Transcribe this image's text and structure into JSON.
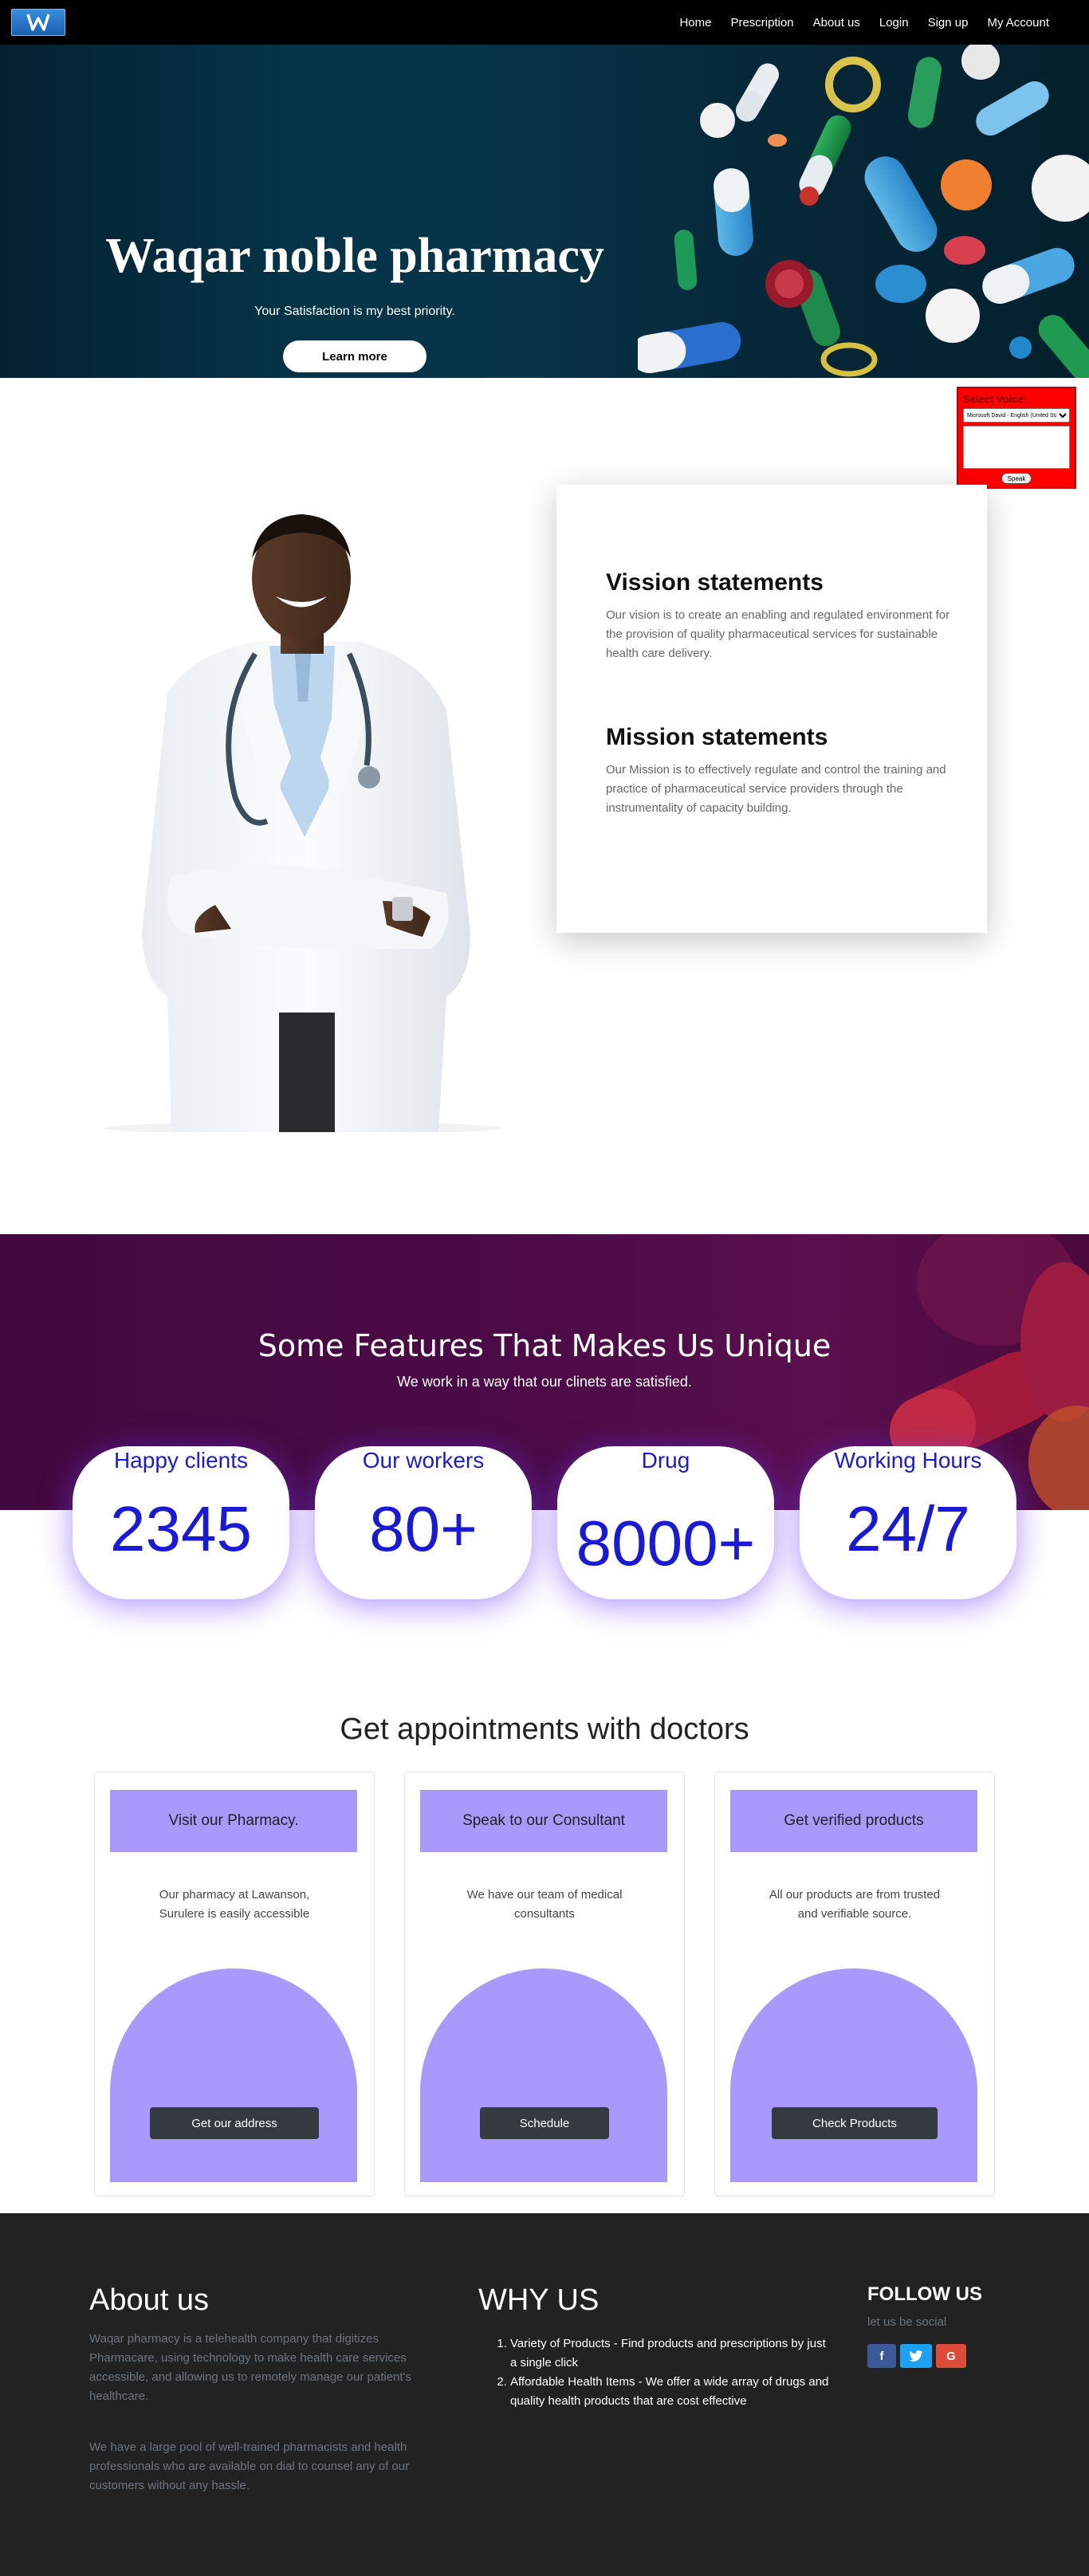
{
  "nav": {
    "logo_alt": "W",
    "links": [
      "Home",
      "Prescription",
      "About us",
      "Login",
      "Sign up",
      "My Account"
    ]
  },
  "hero": {
    "title": "Waqar noble pharmacy",
    "subtitle": "Your Satisfaction is my best priority.",
    "button": "Learn more"
  },
  "voice_widget": {
    "label": "Select Voice:",
    "selected_voice": "Microsoft David - English (United States)",
    "speak_button": "Speak"
  },
  "vision_mission": {
    "vision_title": "Vission statements",
    "vision_text": "Our vision is to create an enabling and regulated environment for the provision of quality pharmaceutical services for sustainable health care delivery.",
    "mission_title": "Mission statements",
    "mission_text": "Our Mission is to effectively regulate and control the training and practice of pharmaceutical service providers through the instrumentality of capacity building."
  },
  "features": {
    "title": "Some Features That Makes Us Unique",
    "subtitle": "We work in a way that our clinets are satisfied.",
    "stats": [
      {
        "label": "Happy clients",
        "value": "2345"
      },
      {
        "label": "Our workers",
        "value": "80+"
      },
      {
        "label": "Drug",
        "value": "8000+"
      },
      {
        "label": "Working Hours",
        "value": "24/7"
      }
    ]
  },
  "appointments": {
    "title": "Get appointments with doctors",
    "cards": [
      {
        "heading": "Visit our Pharmacy.",
        "text": "Our pharmacy at Lawanson, Surulere is easily accessible",
        "button": "Get our address"
      },
      {
        "heading": "Speak to our Consultant",
        "text": "We have our team of medical consultants",
        "button": "Schedule"
      },
      {
        "heading": "Get verified products",
        "text": "All our products are from trusted and verifiable source.",
        "button": "Check Products"
      }
    ]
  },
  "footer": {
    "about_title": "About us",
    "about_p1": "Waqar pharmacy is a telehealth company that digitizes Pharmacare, using technology to make health care services accessible, and allowing us to remotely manage our patient's healthcare.",
    "about_p2": "We have a large pool of well-trained pharmacists and health professionals who are available on dial to counsel any of our customers without any hassle.",
    "why_title": "WHY US",
    "why_items": [
      "Variety of Products - Find products and prescriptions by just a single click",
      "Affordable Health Items - We offer a wide array of drugs and quality health products that are cost effective"
    ],
    "follow_title": "FOLLOW US",
    "follow_sub": "let us be social",
    "social": [
      {
        "icon": "facebook-icon",
        "glyph": "f",
        "color": "#3b5998"
      },
      {
        "icon": "twitter-icon",
        "glyph": "t",
        "color": "#1da1f2"
      },
      {
        "icon": "google-icon",
        "glyph": "G",
        "color": "#dd4b39"
      }
    ]
  }
}
